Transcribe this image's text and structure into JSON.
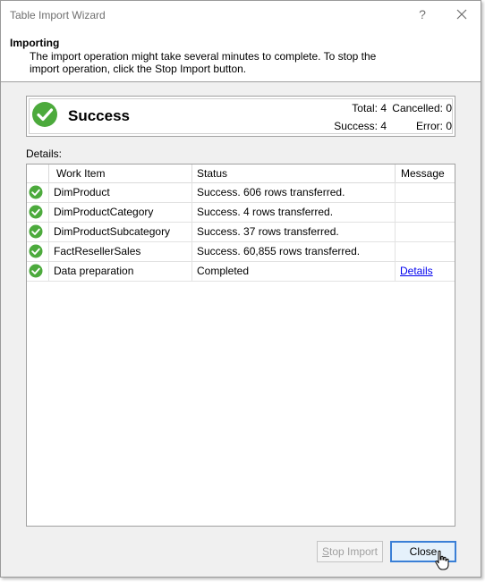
{
  "window": {
    "title": "Table Import Wizard",
    "help_glyph": "?"
  },
  "header": {
    "title": "Importing",
    "description": "The import operation might take several minutes to complete. To stop the import operation, click the Stop Import button."
  },
  "status": {
    "label": "Success",
    "total_label": "Total: 4",
    "cancelled_label": "Cancelled: 0",
    "success_label": "Success: 4",
    "error_label": "Error: 0",
    "icon": "success-check-icon"
  },
  "details": {
    "label": "Details:",
    "columns": [
      "Work Item",
      "Status",
      "Message"
    ],
    "rows": [
      {
        "work_item": "DimProduct",
        "status": "Success. 606 rows transferred.",
        "message": ""
      },
      {
        "work_item": "DimProductCategory",
        "status": "Success. 4 rows transferred.",
        "message": ""
      },
      {
        "work_item": "DimProductSubcategory",
        "status": "Success. 37 rows transferred.",
        "message": ""
      },
      {
        "work_item": "FactResellerSales",
        "status": "Success. 60,855 rows transferred.",
        "message": ""
      },
      {
        "work_item": "Data preparation",
        "status": "Completed",
        "message": "Details"
      }
    ]
  },
  "buttons": {
    "stop_import_prefix": "S",
    "stop_import_rest": "top Import",
    "close": "Close"
  },
  "colors": {
    "success_green": "#4caa3c",
    "link_blue": "#0000ee",
    "default_button_border": "#3a7fd6"
  }
}
